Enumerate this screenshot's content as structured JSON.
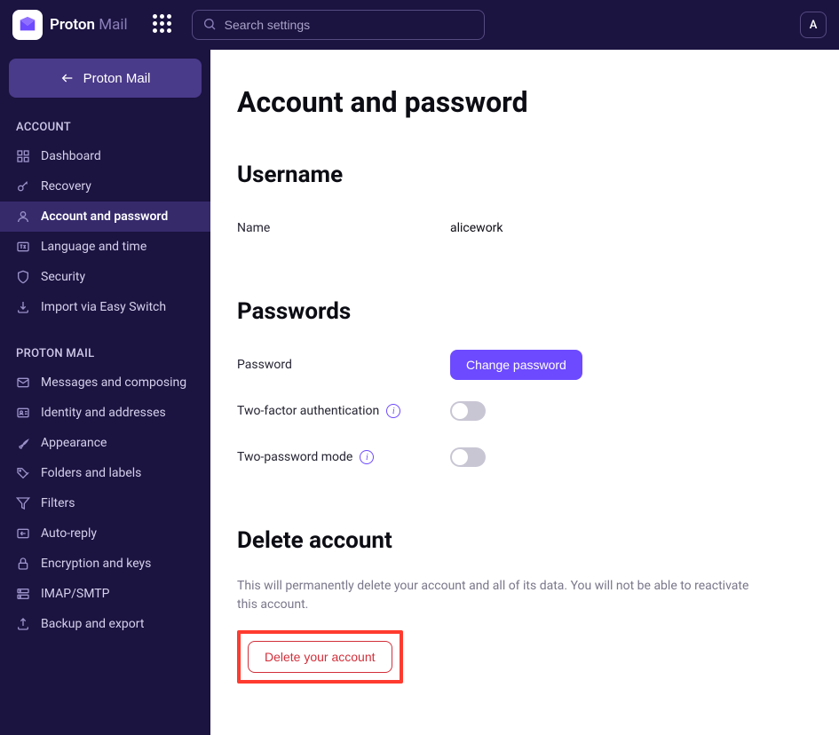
{
  "brand": {
    "name": "Proton",
    "suffix": "Mail"
  },
  "search": {
    "placeholder": "Search settings"
  },
  "avatar": {
    "initial": "A"
  },
  "sidebar": {
    "back_button": "Proton Mail",
    "section_account": "ACCOUNT",
    "section_mail": "PROTON MAIL",
    "account_items": [
      {
        "label": "Dashboard"
      },
      {
        "label": "Recovery"
      },
      {
        "label": "Account and password"
      },
      {
        "label": "Language and time"
      },
      {
        "label": "Security"
      },
      {
        "label": "Import via Easy Switch"
      }
    ],
    "mail_items": [
      {
        "label": "Messages and composing"
      },
      {
        "label": "Identity and addresses"
      },
      {
        "label": "Appearance"
      },
      {
        "label": "Folders and labels"
      },
      {
        "label": "Filters"
      },
      {
        "label": "Auto-reply"
      },
      {
        "label": "Encryption and keys"
      },
      {
        "label": "IMAP/SMTP"
      },
      {
        "label": "Backup and export"
      }
    ]
  },
  "page": {
    "title": "Account and password",
    "username_section": "Username",
    "name_label": "Name",
    "name_value": "alicework",
    "passwords_section": "Passwords",
    "password_label": "Password",
    "change_password_btn": "Change password",
    "twofa_label": "Two-factor authentication",
    "twopass_label": "Two-password mode",
    "delete_section": "Delete account",
    "delete_desc": "This will permanently delete your account and all of its data. You will not be able to reactivate this account.",
    "delete_btn": "Delete your account"
  }
}
